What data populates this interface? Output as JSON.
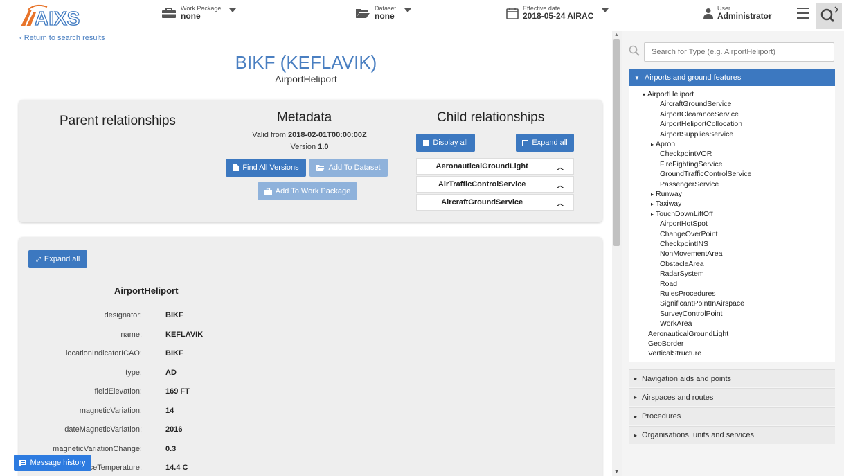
{
  "header": {
    "work_package": {
      "label": "Work Package",
      "value": "none"
    },
    "dataset": {
      "label": "Dataset",
      "value": "none"
    },
    "effective_date": {
      "label": "Effective date",
      "value": "2018-05-24 AIRAC"
    },
    "user": {
      "label": "User",
      "value": "Administrator"
    }
  },
  "back_link": "‹ Return to search results",
  "feature": {
    "title": "BIKF (KEFLAVIK)",
    "type": "AirportHeliport"
  },
  "parent": {
    "heading": "Parent relationships"
  },
  "metadata": {
    "heading": "Metadata",
    "valid_from_label": "Valid from",
    "valid_from": "2018-02-01T00:00:00Z",
    "version_label": "Version",
    "version": "1.0",
    "find_all_versions": "Find All Versions",
    "add_to_dataset": "Add To Dataset",
    "add_to_work_package": "Add To Work Package"
  },
  "child": {
    "heading": "Child relationships",
    "display_all": "Display all",
    "expand_all": "Expand all",
    "items": [
      "AeronauticalGroundLight",
      "AirTrafficControlService",
      "AircraftGroundService"
    ]
  },
  "details": {
    "expand_all": "Expand all",
    "heading": "AirportHeliport",
    "props": [
      {
        "k": "designator:",
        "v": "BIKF"
      },
      {
        "k": "name:",
        "v": "KEFLAVIK"
      },
      {
        "k": "locationIndicatorICAO:",
        "v": "BIKF"
      },
      {
        "k": "type:",
        "v": "AD"
      },
      {
        "k": "fieldElevation:",
        "v": "169 FT"
      },
      {
        "k": "magneticVariation:",
        "v": "14"
      },
      {
        "k": "dateMagneticVariation:",
        "v": "2016"
      },
      {
        "k": "magneticVariationChange:",
        "v": "0.3"
      },
      {
        "k": "referenceTemperature:",
        "v": "14.4 C"
      }
    ]
  },
  "message_history": "Message history",
  "sidebar": {
    "search_placeholder": "Search for Type (e.g. AirportHeliport)",
    "active_category": "Airports and ground features",
    "tree": [
      {
        "label": "AirportHeliport",
        "marker": "▾",
        "level": 0
      },
      {
        "label": "AircraftGroundService",
        "marker": "",
        "level": 2
      },
      {
        "label": "AirportClearanceService",
        "marker": "",
        "level": 2
      },
      {
        "label": "AirportHeliportCollocation",
        "marker": "",
        "level": 2
      },
      {
        "label": "AirportSuppliesService",
        "marker": "",
        "level": 2
      },
      {
        "label": "Apron",
        "marker": "▸",
        "level": 1
      },
      {
        "label": "CheckpointVOR",
        "marker": "",
        "level": 2
      },
      {
        "label": "FireFightingService",
        "marker": "",
        "level": 2
      },
      {
        "label": "GroundTrafficControlService",
        "marker": "",
        "level": 2
      },
      {
        "label": "PassengerService",
        "marker": "",
        "level": 2
      },
      {
        "label": "Runway",
        "marker": "▸",
        "level": 1
      },
      {
        "label": "Taxiway",
        "marker": "▸",
        "level": 1
      },
      {
        "label": "TouchDownLiftOff",
        "marker": "▸",
        "level": 1
      },
      {
        "label": "AirportHotSpot",
        "marker": "",
        "level": 2
      },
      {
        "label": "ChangeOverPoint",
        "marker": "",
        "level": 2
      },
      {
        "label": "CheckpointINS",
        "marker": "",
        "level": 2
      },
      {
        "label": "NonMovementArea",
        "marker": "",
        "level": 2
      },
      {
        "label": "ObstacleArea",
        "marker": "",
        "level": 2
      },
      {
        "label": "RadarSystem",
        "marker": "",
        "level": 2
      },
      {
        "label": "Road",
        "marker": "",
        "level": 2
      },
      {
        "label": "RulesProcedures",
        "marker": "",
        "level": 2
      },
      {
        "label": "SignificantPointInAirspace",
        "marker": "",
        "level": 2
      },
      {
        "label": "SurveyControlPoint",
        "marker": "",
        "level": 2
      },
      {
        "label": "WorkArea",
        "marker": "",
        "level": 2
      },
      {
        "label": "AeronauticalGroundLight",
        "marker": "",
        "level": 3
      },
      {
        "label": "GeoBorder",
        "marker": "",
        "level": 3
      },
      {
        "label": "VerticalStructure",
        "marker": "",
        "level": 3
      }
    ],
    "categories": [
      "Navigation aids and points",
      "Airspaces and routes",
      "Procedures",
      "Organisations, units and services"
    ]
  },
  "colors": {
    "accent": "#3c78c0",
    "title": "#4a7fc1",
    "disabled": "#8fb2db",
    "message_button": "#2d7be0"
  }
}
